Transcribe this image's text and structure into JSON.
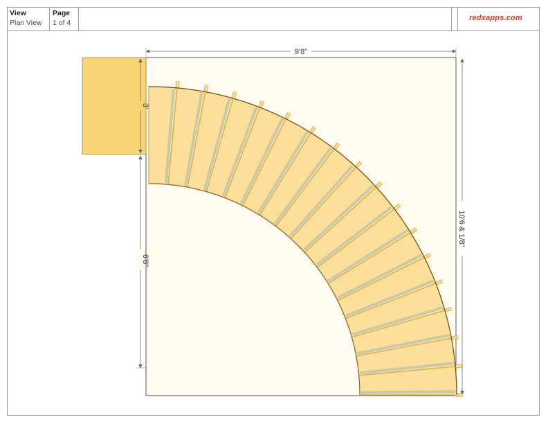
{
  "header": {
    "view_heading": "View",
    "view_value": "Plan View",
    "page_heading": "Page",
    "page_value": "1 of 4",
    "brand": "redxapps.com"
  },
  "dimensions": {
    "top_width": "9'8\"",
    "landing_depth": "3'",
    "left_height": "6'8\"",
    "right_height": "10'6 & 1/8\""
  },
  "colors": {
    "landing": "#f9d474",
    "tread": "#fbdf9a",
    "tread_edge": "#d4a64a",
    "stringer": "#c9c9a8",
    "floor": "#fefcf0",
    "brand": "#d93a2b"
  },
  "stair": {
    "treads": 17,
    "turn_degrees": 90
  }
}
